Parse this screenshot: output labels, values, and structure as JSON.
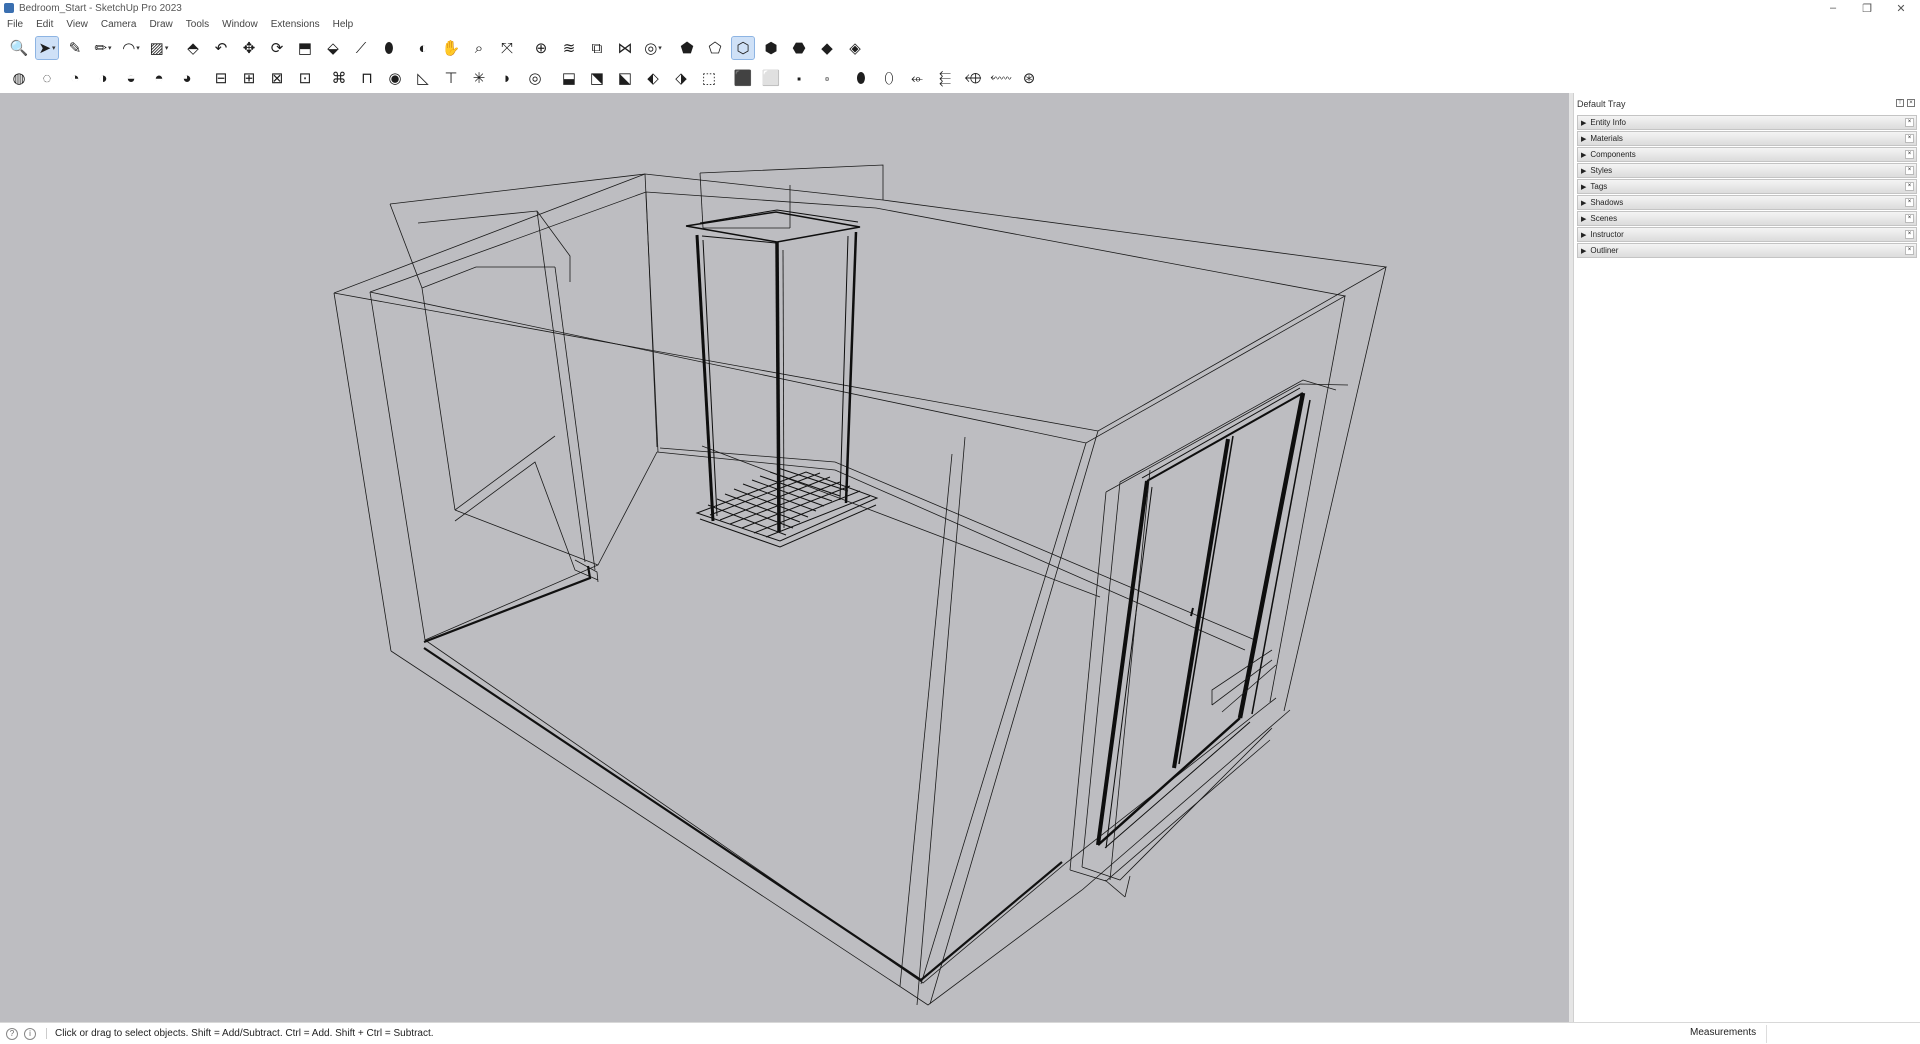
{
  "window": {
    "title": "Bedroom_Start - SketchUp Pro 2023",
    "minimize": "–",
    "restore": "❐",
    "close": "✕"
  },
  "menu": [
    "File",
    "Edit",
    "View",
    "Camera",
    "Draw",
    "Tools",
    "Window",
    "Extensions",
    "Help"
  ],
  "toolbar1": [
    {
      "name": "zoom-icon",
      "glyph": "🔍"
    },
    {
      "name": "select-icon",
      "glyph": "➤",
      "active": true,
      "dropdown": true
    },
    {
      "name": "eraser-icon",
      "glyph": "✎"
    },
    {
      "name": "line-icon",
      "glyph": "✏",
      "dropdown": true
    },
    {
      "name": "arc-icon",
      "glyph": "◠",
      "dropdown": true
    },
    {
      "name": "rectangle-icon",
      "glyph": "▨",
      "dropdown": true
    },
    {
      "name": "push-pull-icon",
      "glyph": "⬘"
    },
    {
      "name": "offset-icon",
      "glyph": "↶"
    },
    {
      "name": "move-icon",
      "glyph": "✥"
    },
    {
      "name": "rotate-icon",
      "glyph": "⟳"
    },
    {
      "name": "scale-icon",
      "glyph": "⬒"
    },
    {
      "name": "follow-me-icon",
      "glyph": "⬙"
    },
    {
      "name": "tape-measure-icon",
      "glyph": "⟋"
    },
    {
      "name": "paint-bucket-icon",
      "glyph": "⬮"
    },
    {
      "name": "orbit-icon",
      "glyph": "◐"
    },
    {
      "name": "pan-icon",
      "glyph": "✋"
    },
    {
      "name": "zoom-tool-icon",
      "glyph": "⌕"
    },
    {
      "name": "zoom-extents-icon",
      "glyph": "⤧"
    },
    {
      "name": "warehouse-icon",
      "glyph": "⊕"
    },
    {
      "name": "extension-warehouse-icon",
      "glyph": "≋"
    },
    {
      "name": "layout-icon",
      "glyph": "⧉"
    },
    {
      "name": "trimble-connect-icon",
      "glyph": "⋈"
    },
    {
      "name": "account-icon",
      "glyph": "◎",
      "dropdown": true
    },
    {
      "name": "xray-icon",
      "glyph": "⬟"
    },
    {
      "name": "back-edges-icon",
      "glyph": "⬠"
    },
    {
      "name": "wireframe-icon",
      "glyph": "⬡",
      "active": true
    },
    {
      "name": "hidden-line-icon",
      "glyph": "⬢"
    },
    {
      "name": "shaded-icon",
      "glyph": "⬣"
    },
    {
      "name": "shaded-textures-icon",
      "glyph": "◆"
    },
    {
      "name": "monochrome-icon",
      "glyph": "◈"
    }
  ],
  "toolbar2": [
    {
      "name": "solid-union-icon",
      "glyph": "◍"
    },
    {
      "name": "solid-subtract-icon",
      "glyph": "◌"
    },
    {
      "name": "solid-trim-icon",
      "glyph": "◔"
    },
    {
      "name": "solid-intersect-icon",
      "glyph": "◑"
    },
    {
      "name": "solid-outer-shell-icon",
      "glyph": "◒"
    },
    {
      "name": "solid-split-icon",
      "glyph": "◓"
    },
    {
      "name": "solid-inspector-icon",
      "glyph": "◕"
    },
    {
      "name": "section-plane-icon",
      "glyph": "⊟"
    },
    {
      "name": "section-cuts-icon",
      "glyph": "⊞"
    },
    {
      "name": "section-fill-icon",
      "glyph": "⊠"
    },
    {
      "name": "lock-icon",
      "glyph": "⊡"
    },
    {
      "name": "sandbox-contours-icon",
      "glyph": "⌘"
    },
    {
      "name": "sandbox-scratch-icon",
      "glyph": "⊓"
    },
    {
      "name": "sandbox-smoove-icon",
      "glyph": "◉"
    },
    {
      "name": "sandbox-stamp-icon",
      "glyph": "◺"
    },
    {
      "name": "sandbox-drape-icon",
      "glyph": "⊤"
    },
    {
      "name": "sandbox-add-detail-icon",
      "glyph": "✳"
    },
    {
      "name": "sandbox-flip-edge-icon",
      "glyph": "◗"
    },
    {
      "name": "sandbox-slope-icon",
      "glyph": "◎"
    },
    {
      "name": "iso-view-icon",
      "glyph": "⬓"
    },
    {
      "name": "top-view-icon",
      "glyph": "⬔"
    },
    {
      "name": "front-view-icon",
      "glyph": "⬕"
    },
    {
      "name": "right-view-icon",
      "glyph": "⬖"
    },
    {
      "name": "back-view-icon",
      "glyph": "⬗"
    },
    {
      "name": "left-view-icon",
      "glyph": "⬚"
    },
    {
      "name": "bottom-view-icon",
      "glyph": "⬛"
    },
    {
      "name": "parallel-projection-icon",
      "glyph": "⬜"
    },
    {
      "name": "perspective-icon",
      "glyph": "⬝"
    },
    {
      "name": "two-point-icon",
      "glyph": "⬞"
    },
    {
      "name": "position-camera-icon",
      "glyph": "⬮"
    },
    {
      "name": "walk-icon",
      "glyph": "⬯"
    },
    {
      "name": "look-around-icon",
      "glyph": "⬰"
    },
    {
      "name": "texture-position-icon",
      "glyph": "⬱"
    },
    {
      "name": "match-photo-icon",
      "glyph": "⬲"
    },
    {
      "name": "styles-icon",
      "glyph": "⬳"
    },
    {
      "name": "dynamic-components-icon",
      "glyph": "⊛"
    }
  ],
  "tray": {
    "title": "Default Tray",
    "panels": [
      "Entity Info",
      "Materials",
      "Components",
      "Styles",
      "Tags",
      "Shadows",
      "Scenes",
      "Instructor",
      "Outliner"
    ]
  },
  "status": {
    "text": "Click or drag to select objects. Shift = Add/Subtract. Ctrl = Add. Shift + Ctrl = Subtract.",
    "measurements_label": "Measurements"
  }
}
